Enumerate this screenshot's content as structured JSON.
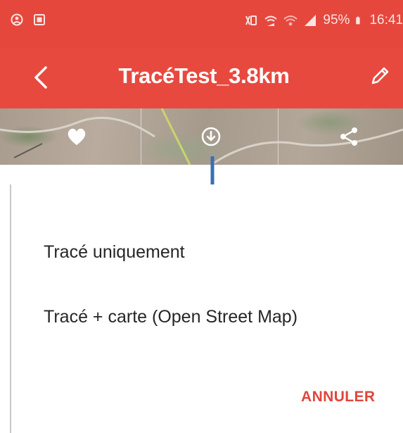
{
  "status_bar": {
    "left_icons": [
      "alarm-icon",
      "notification-icon"
    ],
    "right_icons": [
      "vibrate-icon",
      "wifi-calling-icon",
      "wifi-icon",
      "signal-icon",
      "battery-icon"
    ],
    "battery": "95%",
    "time": "16:41"
  },
  "app_bar": {
    "title": "TracéTest_3.8km",
    "back_icon": "chevron-left-icon",
    "edit_icon": "pencil-icon"
  },
  "map_actions": {
    "favorite_icon": "heart-icon",
    "download_icon": "download-icon",
    "share_icon": "share-icon"
  },
  "annotation": {
    "arrow_color": "#3a6fb3"
  },
  "dialog": {
    "options": [
      "Tracé uniquement",
      "Tracé + carte (Open Street Map)"
    ],
    "cancel_label": "ANNULER"
  },
  "colors": {
    "brand_red": "#e8493f",
    "accent_text": "#e0463c"
  }
}
